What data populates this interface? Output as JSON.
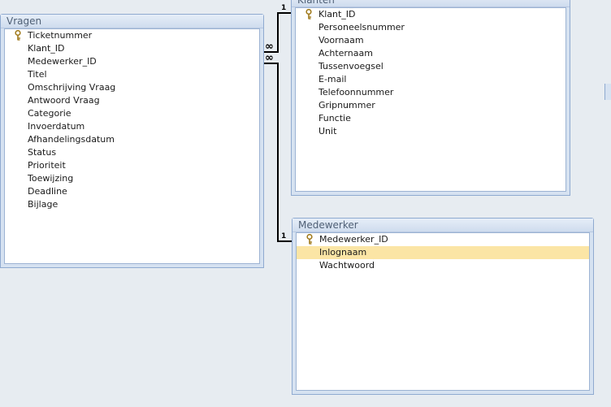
{
  "tables": {
    "vragen": {
      "title": "Vragen",
      "fields": [
        "Ticketnummer",
        "Klant_ID",
        "Medewerker_ID",
        "Titel",
        "Omschrijving Vraag",
        "Antwoord Vraag",
        "Categorie",
        "Invoerdatum",
        "Afhandelingsdatum",
        "Status",
        "Prioriteit",
        "Toewijzing",
        "Deadline",
        "Bijlage"
      ],
      "primary_key": "Ticketnummer"
    },
    "klanten": {
      "title": "Klanten",
      "fields": [
        "Klant_ID",
        "Personeelsnummer",
        "Voornaam",
        "Achternaam",
        "Tussenvoegsel",
        "E-mail",
        "Telefoonnummer",
        "Gripnummer",
        "Functie",
        "Unit"
      ],
      "primary_key": "Klant_ID"
    },
    "medewerker": {
      "title": "Medewerker",
      "fields": [
        "Medewerker_ID",
        "Inlognaam",
        "Wachtwoord"
      ],
      "primary_key": "Medewerker_ID",
      "selected_field": "Inlognaam"
    }
  },
  "relationships": [
    {
      "from": "Vragen.Klant_ID",
      "to": "Klanten.Klant_ID",
      "many_label": "∞",
      "one_label": "1"
    },
    {
      "from": "Vragen.Medewerker_ID",
      "to": "Medewerker.Medewerker_ID",
      "many_label": "∞",
      "one_label": "1"
    }
  ],
  "colors": {
    "canvas": "#e7ecf1",
    "table_frame": "#d6e2f1",
    "title_text": "#4f6076",
    "selection": "#fbe5a5"
  },
  "icons": {
    "primary_key": "key-icon"
  }
}
